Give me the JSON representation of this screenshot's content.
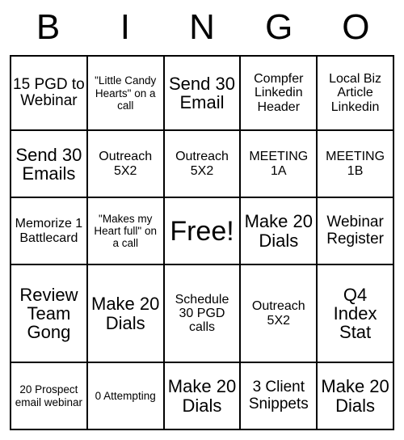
{
  "card": {
    "header_letters": [
      "B",
      "I",
      "N",
      "G",
      "O"
    ],
    "columns": 5,
    "rows": 5,
    "border_color": "#000000",
    "background_color": "#ffffff",
    "text_color": "#000000",
    "free_space": {
      "row": 2,
      "col": 2,
      "label": "Free!"
    },
    "cells": [
      [
        {
          "text": "15 PGD to Webinar",
          "size": "md"
        },
        {
          "text": "\"Little Candy Hearts\" on a call",
          "size": "xs"
        },
        {
          "text": "Send 30 Email",
          "size": "lg"
        },
        {
          "text": "Compfer Linkedin Header",
          "size": "sm"
        },
        {
          "text": "Local Biz Article Linkedin",
          "size": "sm"
        }
      ],
      [
        {
          "text": "Send 30 Emails",
          "size": "lg"
        },
        {
          "text": "Outreach 5X2",
          "size": "sm"
        },
        {
          "text": "Outreach 5X2",
          "size": "sm"
        },
        {
          "text": "MEETING 1A",
          "size": "sm"
        },
        {
          "text": "MEETING 1B",
          "size": "sm"
        }
      ],
      [
        {
          "text": "Memorize 1 Battlecard",
          "size": "sm"
        },
        {
          "text": "\"Makes my Heart full\" on a call",
          "size": "xs"
        },
        {
          "text": "Free!",
          "size": "free"
        },
        {
          "text": "Make 20 Dials",
          "size": "lg"
        },
        {
          "text": "Webinar Register",
          "size": "md"
        }
      ],
      [
        {
          "text": "Review Team Gong",
          "size": "lg"
        },
        {
          "text": "Make 20 Dials",
          "size": "lg"
        },
        {
          "text": "Schedule 30 PGD calls",
          "size": "sm"
        },
        {
          "text": "Outreach 5X2",
          "size": "sm"
        },
        {
          "text": "Q4 Index Stat",
          "size": "lg"
        }
      ],
      [
        {
          "text": "20 Prospect email webinar",
          "size": "xs"
        },
        {
          "text": "0 Attempting",
          "size": "xs"
        },
        {
          "text": "Make 20 Dials",
          "size": "lg"
        },
        {
          "text": "3 Client Snippets",
          "size": "md"
        },
        {
          "text": "Make 20 Dials",
          "size": "lg"
        }
      ]
    ]
  }
}
